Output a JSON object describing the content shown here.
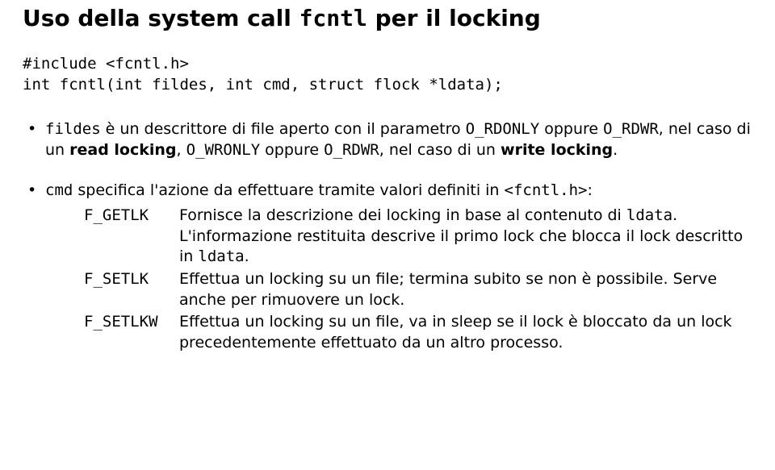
{
  "title_pre": "Uso della system call ",
  "title_code": "fcntl",
  "title_post": " per il locking",
  "code_line1": "#include <fcntl.h>",
  "code_line2": "int fcntl(int fildes, int cmd, struct flock *ldata);",
  "bullet1": {
    "p1_code": "fildes",
    "p1_txt1": " è un descrittore di file aperto con il parametro ",
    "p1_code2": "O_RDONLY",
    "p1_txt2": " oppure ",
    "p1_code3": "O_RDWR",
    "p1_txt3": ", nel caso di un ",
    "p1_bold": "read locking",
    "p1_txt4": ", ",
    "p1_code4": "O_WRONLY",
    "p1_txt5": " oppure ",
    "p1_code5": "O_RDWR",
    "p1_txt6": ", nel caso di un ",
    "p1_bold2": "write locking",
    "p1_txt7": "."
  },
  "bullet2": {
    "p_code": "cmd",
    "p_txt1": " specifica l'azione da effettuare tramite valori definiti in ",
    "p_code2": "<fcntl.h>",
    "p_txt2": ":"
  },
  "defs": {
    "t1": "F_GETLK",
    "d1_a": "Fornisce la descrizione dei locking in base al contenuto di ",
    "d1_code1": "ldata",
    "d1_b": ". L'informazione restituita descrive il primo lock che blocca il lock descritto in ",
    "d1_code2": "ldata",
    "d1_c": ".",
    "t2": "F_SETLK",
    "d2": "Effettua un locking su un file; termina subito se non è possibile. Serve anche per rimuovere un lock.",
    "t3": "F_SETLKW",
    "d3": "Effettua un locking su un file, va in sleep se il lock è bloccato da un lock precedentemente effettuato da un altro processo."
  }
}
